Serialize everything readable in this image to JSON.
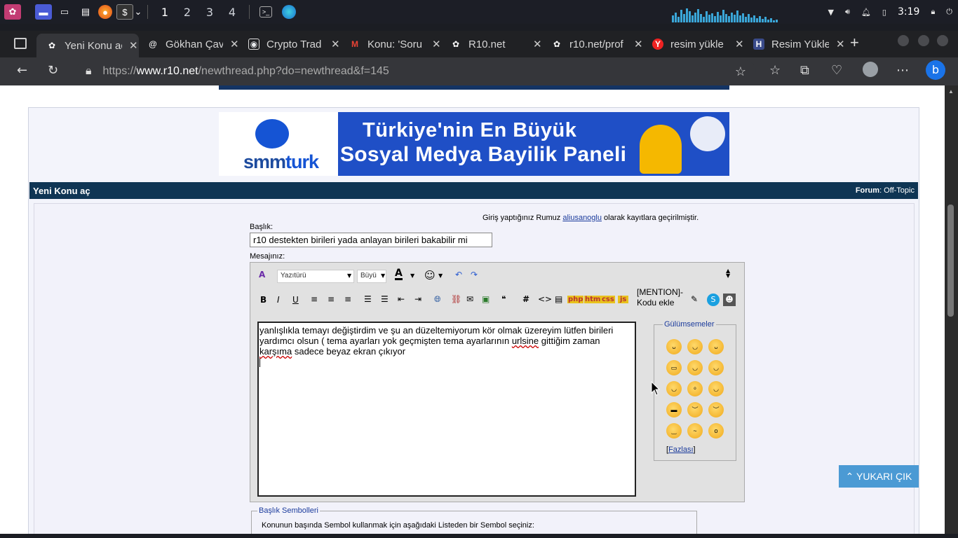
{
  "taskbar": {
    "workspaces": [
      "1",
      "2",
      "3",
      "4"
    ],
    "clock": "3:19"
  },
  "tabs": [
    {
      "label": "Yeni Konu aç"
    },
    {
      "label": "Gökhan Çav"
    },
    {
      "label": "Crypto Trad"
    },
    {
      "label": "Konu: 'Soru"
    },
    {
      "label": "R10.net"
    },
    {
      "label": "r10.net/prof"
    },
    {
      "label": "resim yükle"
    },
    {
      "label": "Resim Yükle"
    }
  ],
  "address": {
    "scheme": "https://",
    "host": "www.r10.net",
    "path": "/newthread.php?do=newthread&f=145"
  },
  "banner": {
    "logo": "smm",
    "logo_b": "turk",
    "line1": "Türkiye'nin En Büyük",
    "line2": "Sosyal Medya Bayilik Paneli"
  },
  "titlebar": {
    "title": "Yeni Konu aç",
    "forum_label": "Forum",
    "forum_value": ": Off-Topic"
  },
  "login": {
    "prefix": "Giriş yaptığınız Rumuz ",
    "user": "aliusanoglu",
    "suffix": " olarak kayıtlara geçirilmiştir."
  },
  "form": {
    "subject_label": "Başlık:",
    "subject_value": "r10 destekten birileri yada anlayan birileri bakabilir mi",
    "message_label": "Mesajınız:",
    "font_select": "Yazıtürü",
    "size_select": "Büyü",
    "message_line1": "yanlışlıkla temayı değiştirdim ve şu an düzeltemiyorum kör olmak üzereyim lütfen birileri",
    "message_line2a": "yardımcı olsun ( tema ayarları yok geçmişten tema ayarlarının ",
    "message_line2b": "urlsine",
    "message_line2c": " gittiğim zaman",
    "message_line3a": "karşıma",
    "message_line3b": " sadece beyaz ekran çıkıyor",
    "mention": "[MENTION]-Kodu ekle",
    "code_buttons": [
      "php",
      "htm",
      "css",
      "js"
    ]
  },
  "smilies": {
    "legend": "Gülümsemeler",
    "more": "Fazlası"
  },
  "symbols": {
    "legend": "Başlık Sembolleri",
    "text": "Konunun başında Sembol kullanmak için aşağıdaki Listeden bir Sembol seçiniz:"
  },
  "scroll_top": "YUKARI ÇIK"
}
